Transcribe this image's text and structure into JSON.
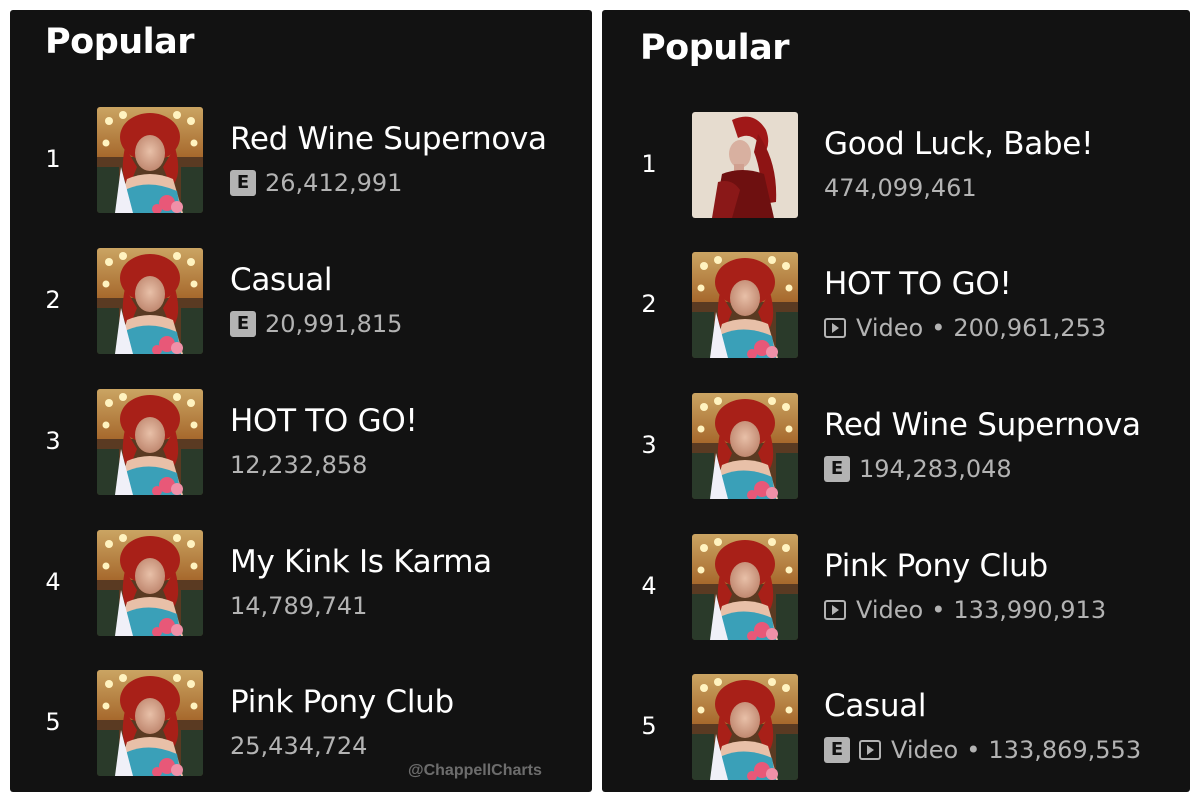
{
  "left_panel": {
    "title": "Popular",
    "tracks": [
      {
        "rank": "1",
        "title": "Red Wine Supernova",
        "explicit": true,
        "streams": "26,412,991"
      },
      {
        "rank": "2",
        "title": "Casual",
        "explicit": true,
        "streams": "20,991,815"
      },
      {
        "rank": "3",
        "title": "HOT TO GO!",
        "explicit": false,
        "streams": "12,232,858"
      },
      {
        "rank": "4",
        "title": "My Kink Is Karma",
        "explicit": false,
        "streams": "14,789,741"
      },
      {
        "rank": "5",
        "title": "Pink Pony Club",
        "explicit": false,
        "streams": "25,434,724"
      }
    ],
    "watermark": "@ChappellCharts"
  },
  "right_panel": {
    "title": "Popular",
    "tracks": [
      {
        "rank": "1",
        "title": "Good Luck, Babe!",
        "explicit": false,
        "video": false,
        "streams": "474,099,461"
      },
      {
        "rank": "2",
        "title": "HOT TO GO!",
        "explicit": false,
        "video": true,
        "video_label": "Video",
        "separator": "•",
        "streams": "200,961,253"
      },
      {
        "rank": "3",
        "title": "Red Wine Supernova",
        "explicit": true,
        "video": false,
        "streams": "194,283,048"
      },
      {
        "rank": "4",
        "title": "Pink Pony Club",
        "explicit": false,
        "video": true,
        "video_label": "Video",
        "separator": "•",
        "streams": "133,990,913"
      },
      {
        "rank": "5",
        "title": "Casual",
        "explicit": true,
        "video": true,
        "video_label": "Video",
        "separator": "•",
        "streams": "133,869,553"
      }
    ]
  },
  "explicit_badge": "E",
  "colors": {
    "panel_bg": "#121212",
    "text_primary": "#ffffff",
    "text_secondary": "#b3b3b3"
  },
  "icons": {
    "album_art": "album-cover-art",
    "single_art": "single-cover-art",
    "explicit": "explicit-badge-icon",
    "video": "video-play-icon"
  }
}
